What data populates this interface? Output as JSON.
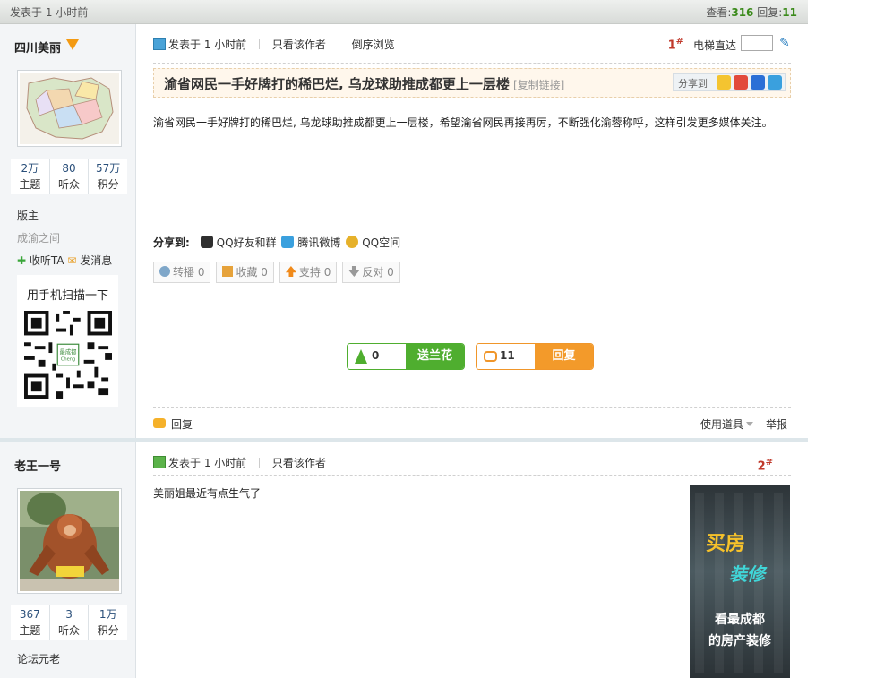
{
  "topbar": {
    "posted": "发表于 1  小时前",
    "views_label": "查看:",
    "views": "316",
    "replies_label": "回复:",
    "replies": "11"
  },
  "posts": [
    {
      "user": {
        "name": "四川美丽",
        "stats": [
          {
            "v": "2万",
            "k": "主题"
          },
          {
            "v": "80",
            "k": "听众"
          },
          {
            "v": "57万",
            "k": "积分"
          }
        ],
        "role": "版主",
        "group": "成渝之间",
        "follow": "收听TA",
        "message": "发消息",
        "qr_title": "用手机扫描一下"
      },
      "head": {
        "posted": "发表于 1 小时前",
        "only_author": "只看该作者",
        "reverse": "倒序浏览",
        "floor": "1",
        "elevator": "电梯直达"
      },
      "title": "渝省网民一手好牌打的稀巴烂, 乌龙球助推成都更上一层楼",
      "copy_link": "[复制链接]",
      "share_to": "分享到",
      "content": "渝省网民一手好牌打的稀巴烂, 乌龙球助推成都更上一层楼，希望渝省网民再接再厉，不断强化渝蓉称呼，这样引发更多媒体关注。",
      "share_label": "分享到:",
      "share_items": [
        "QQ好友和群",
        "腾讯微博",
        "QQ空间"
      ],
      "action_buttons": [
        "转播 0",
        "收藏 0",
        "支持 0",
        "反对 0"
      ],
      "flower": {
        "count": "0",
        "label": "送兰花"
      },
      "reply": {
        "count": "11",
        "label": "回复"
      },
      "foot": {
        "reply": "回复",
        "tools": "使用道具",
        "report": "举报"
      }
    },
    {
      "user": {
        "name": "老王一号",
        "stats": [
          {
            "v": "367",
            "k": "主题"
          },
          {
            "v": "3",
            "k": "听众"
          },
          {
            "v": "1万",
            "k": "积分"
          }
        ],
        "role": "论坛元老"
      },
      "head": {
        "posted": "发表于 1 小时前",
        "only_author": "只看该作者",
        "floor": "2"
      },
      "content": "美丽姐最近有点生气了",
      "ad": {
        "line1": "买房",
        "line2": "装修",
        "line3": "看最成都",
        "line4": "的房产装修"
      }
    }
  ],
  "colors": {
    "accent_green": "#4fae2f",
    "accent_orange": "#f39a2a",
    "floor_red": "#c0392b",
    "stat_blue": "#2a4f7a"
  }
}
